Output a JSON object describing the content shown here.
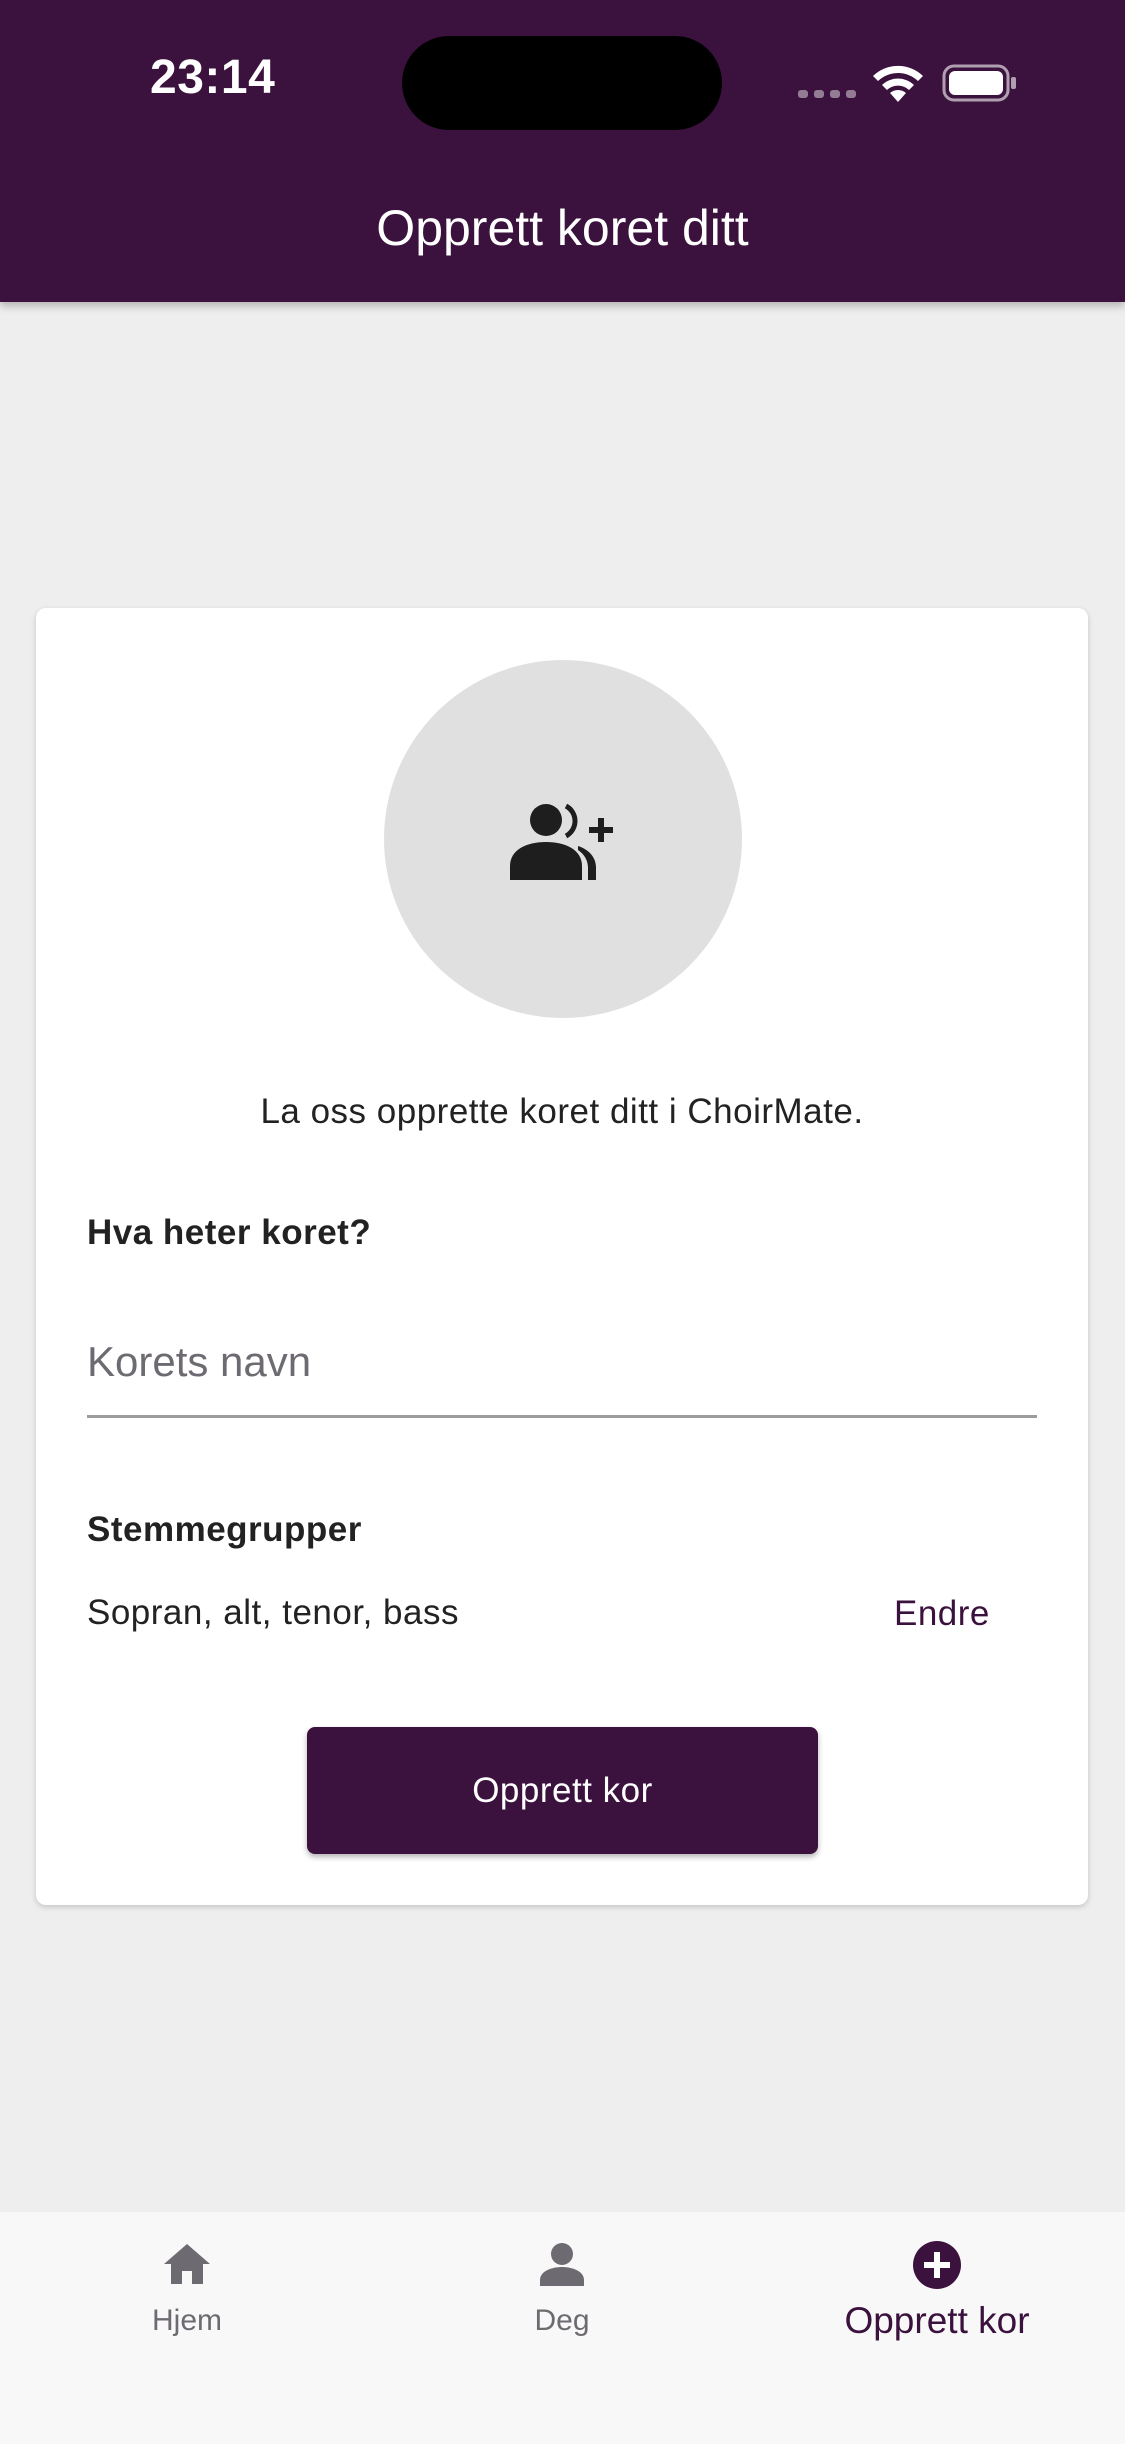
{
  "status_bar": {
    "time": "23:14"
  },
  "header": {
    "title": "Opprett koret ditt"
  },
  "card": {
    "avatar_icon": "group-add-icon",
    "intro_text": "La oss opprette koret ditt i ChoirMate.",
    "name_label": "Hva heter koret?",
    "name_placeholder": "Korets navn",
    "name_value": "",
    "voices_label": "Stemmegrupper",
    "voices_value": "Sopran, alt, tenor, bass",
    "change_label": "Endre",
    "create_label": "Opprett kor"
  },
  "bottom_nav": {
    "items": [
      {
        "label": "Hjem",
        "icon": "home-icon",
        "active": false
      },
      {
        "label": "Deg",
        "icon": "person-icon",
        "active": false
      },
      {
        "label": "Opprett kor",
        "icon": "add-circle-icon",
        "active": true
      }
    ]
  },
  "colors": {
    "primary": "#3b113d",
    "background": "#eeeeee",
    "card": "#ffffff",
    "avatar_bg": "#e0e0e0",
    "nav_inactive": "#6e6a72"
  }
}
